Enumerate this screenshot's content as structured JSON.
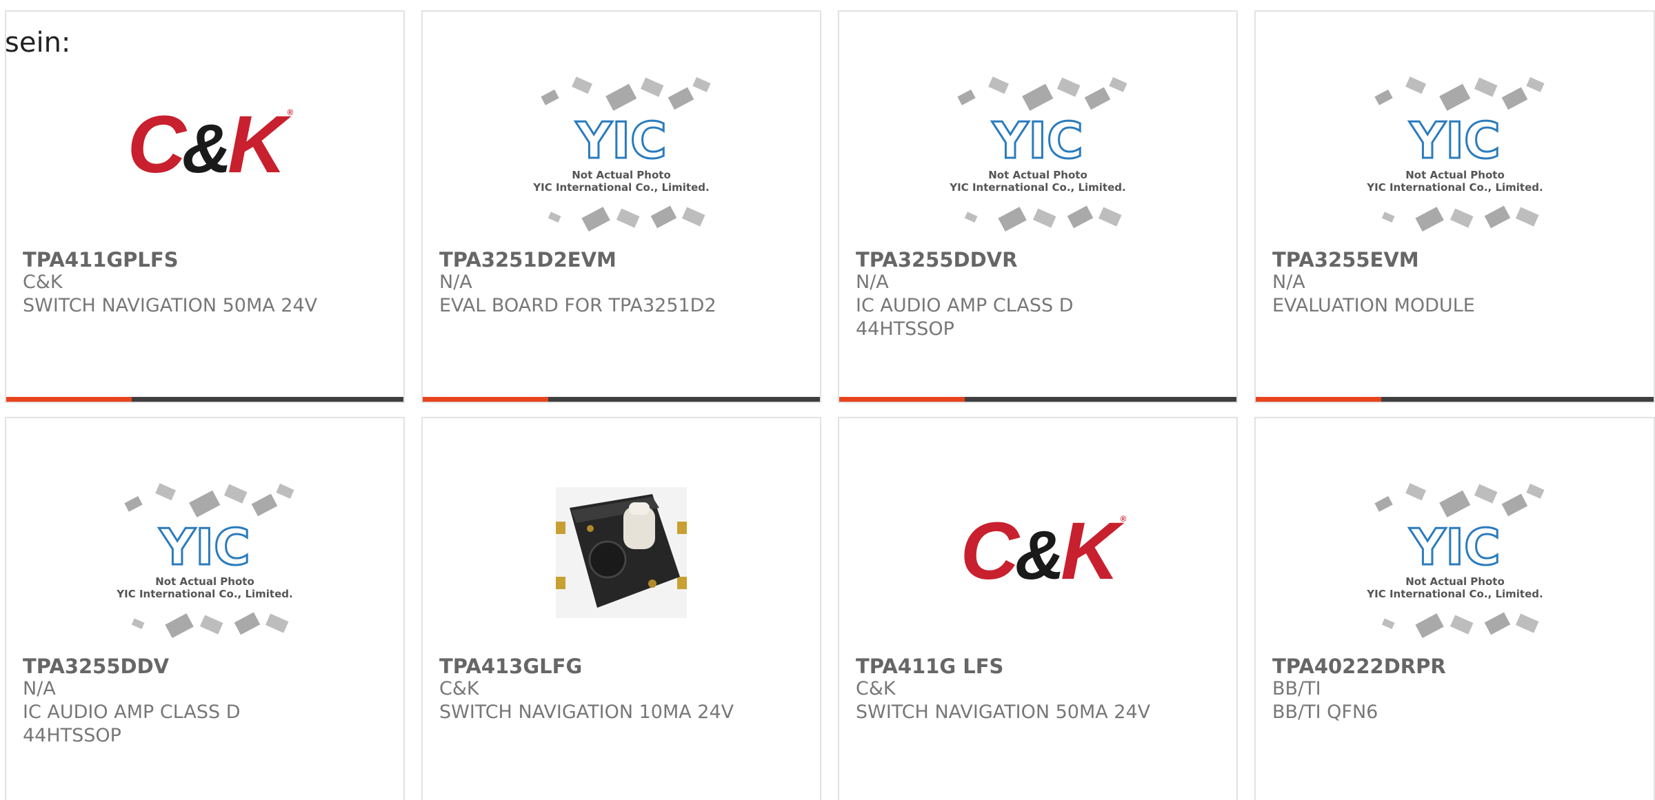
{
  "intro_text": "sein:",
  "placeholder_image": {
    "caption_line1": "Not Actual Photo",
    "caption_line2": "YIC International Co., Limited.",
    "logo_text": "YIC"
  },
  "ck_logo": {
    "c": "C",
    "amp": "&",
    "k": "K",
    "reg": "®"
  },
  "colors": {
    "accent": "#e8441c",
    "bar": "#3f3f3f",
    "card_border": "#e2e2e2",
    "text": "#777777",
    "ck_red": "#c8202e",
    "yic_blue": "#2a7bbd"
  },
  "products": [
    {
      "part": "TPA411GPLFS",
      "manufacturer": "C&K",
      "desc1": "SWITCH NAVIGATION 50MA 24V",
      "desc2": "",
      "image": "ck-logo"
    },
    {
      "part": "TPA3251D2EVM",
      "manufacturer": "N/A",
      "desc1": "EVAL BOARD FOR TPA3251D2",
      "desc2": "",
      "image": "yic-placeholder"
    },
    {
      "part": "TPA3255DDVR",
      "manufacturer": "N/A",
      "desc1": "IC AUDIO AMP CLASS D",
      "desc2": "44HTSSOP",
      "image": "yic-placeholder"
    },
    {
      "part": "TPA3255EVM",
      "manufacturer": "N/A",
      "desc1": "EVALUATION MODULE",
      "desc2": "",
      "image": "yic-placeholder"
    },
    {
      "part": "TPA3255DDV",
      "manufacturer": "N/A",
      "desc1": "IC AUDIO AMP CLASS D",
      "desc2": "44HTSSOP",
      "image": "yic-placeholder"
    },
    {
      "part": "TPA413GLFG",
      "manufacturer": "C&K",
      "desc1": "SWITCH NAVIGATION 10MA 24V",
      "desc2": "",
      "image": "switch-photo"
    },
    {
      "part": "TPA411G LFS",
      "manufacturer": "C&K",
      "desc1": "SWITCH NAVIGATION 50MA 24V",
      "desc2": "",
      "image": "ck-logo"
    },
    {
      "part": "TPA40222DRPR",
      "manufacturer": "BB/TI",
      "desc1": "BB/TI QFN6",
      "desc2": "",
      "image": "yic-placeholder"
    }
  ]
}
